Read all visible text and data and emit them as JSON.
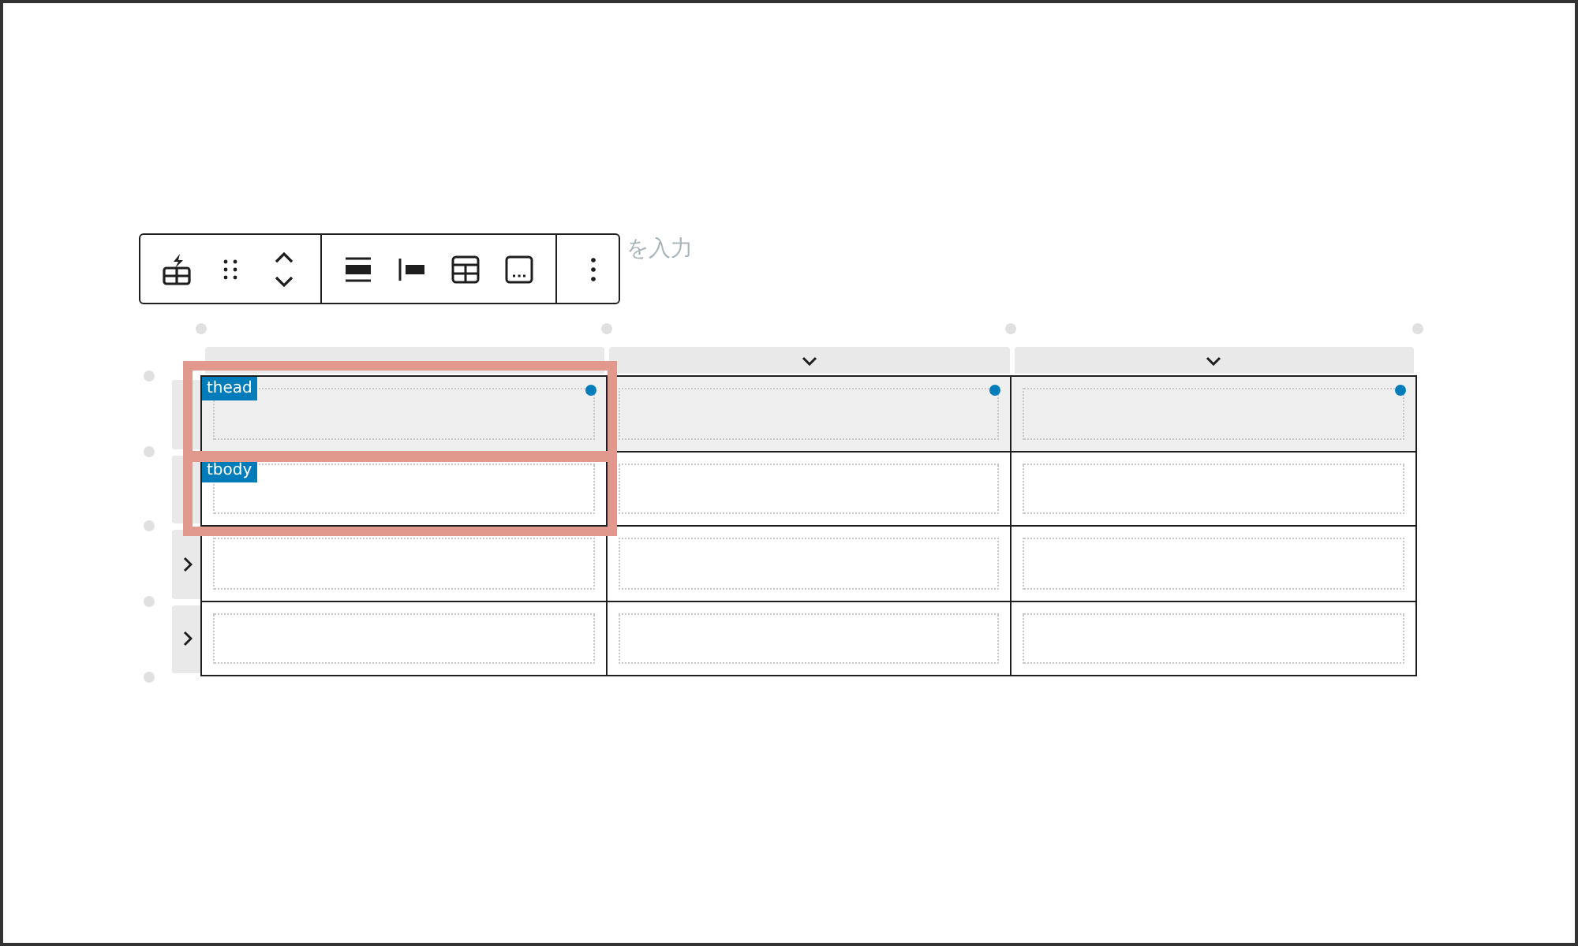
{
  "editor": {
    "placeholder": "を入力"
  },
  "table": {
    "columns": [
      {
        "kind": "column"
      },
      {
        "kind": "column"
      },
      {
        "kind": "column"
      }
    ],
    "rows": [
      {
        "kind": "head",
        "tag": "thead",
        "highlighted": true
      },
      {
        "kind": "body",
        "tag": "tbody",
        "highlighted": true
      },
      {
        "kind": "body",
        "highlighted": false
      },
      {
        "kind": "body",
        "highlighted": false
      }
    ]
  }
}
